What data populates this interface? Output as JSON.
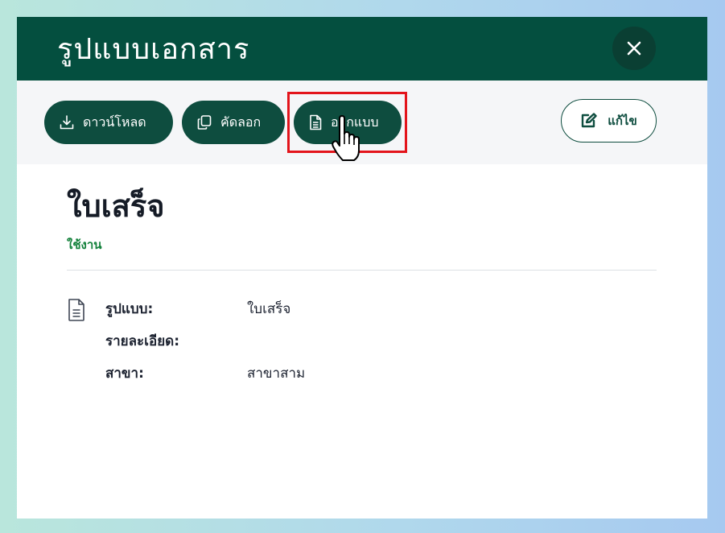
{
  "dialog": {
    "title": "รูปแบบเอกสาร",
    "close_icon": "close-icon"
  },
  "toolbar": {
    "download_label": "ดาวน์โหลด",
    "copy_label": "คัดลอก",
    "design_label": "ออกแบบ",
    "edit_label": "แก้ไข",
    "icons": {
      "download": "download-icon",
      "copy": "copy-icon",
      "design": "document-icon",
      "edit": "edit-icon"
    }
  },
  "document": {
    "name": "ใบเสร็จ",
    "status": "ใช้งาน",
    "fields": [
      {
        "label": "รูปแบบ:",
        "value": "ใบเสร็จ"
      },
      {
        "label": "รายละเอียด:",
        "value": ""
      },
      {
        "label": "สาขา:",
        "value": "สาขาสาม"
      }
    ]
  },
  "colors": {
    "header_bg": "#044f3f",
    "button_bg": "#0e4d3f",
    "status_green": "#13813b",
    "highlight_red": "#e3141b"
  }
}
